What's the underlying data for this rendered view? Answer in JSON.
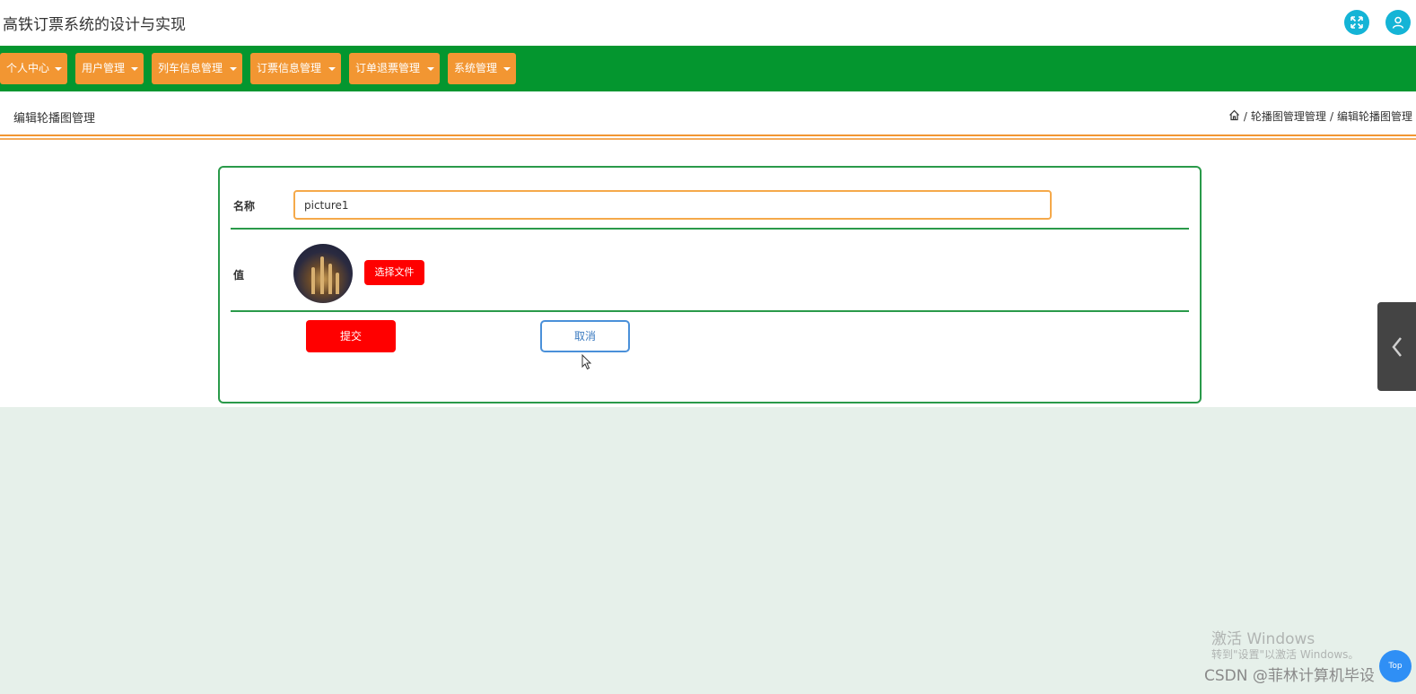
{
  "app": {
    "title": "高铁订票系统的设计与实现"
  },
  "header_icons": [
    "fullscreen-icon",
    "user-icon"
  ],
  "nav": {
    "items": [
      {
        "label": "个人中心"
      },
      {
        "label": "用户管理"
      },
      {
        "label": "列车信息管理"
      },
      {
        "label": "订票信息管理"
      },
      {
        "label": "订单退票管理"
      },
      {
        "label": "系统管理"
      }
    ]
  },
  "page": {
    "title": "编辑轮播图管理",
    "breadcrumb": {
      "sep": "/",
      "parent": "轮播图管理管理",
      "current": "编辑轮播图管理"
    }
  },
  "form": {
    "name_label": "名称",
    "name_value": "picture1",
    "value_label": "值",
    "choose_file_label": "选择文件",
    "submit_label": "提交",
    "cancel_label": "取消"
  },
  "overlay": {
    "activate_title": "激活 Windows",
    "activate_hint": "转到\"设置\"以激活 Windows。",
    "csdn_text": "CSDN @菲林计算机毕设",
    "top_label": "Top"
  },
  "colors": {
    "nav_bg": "#04962f",
    "nav_item": "#f29632",
    "accent_red": "#ff0000",
    "card_border": "#2a9a4a",
    "page_bg": "#e6f0ea"
  }
}
